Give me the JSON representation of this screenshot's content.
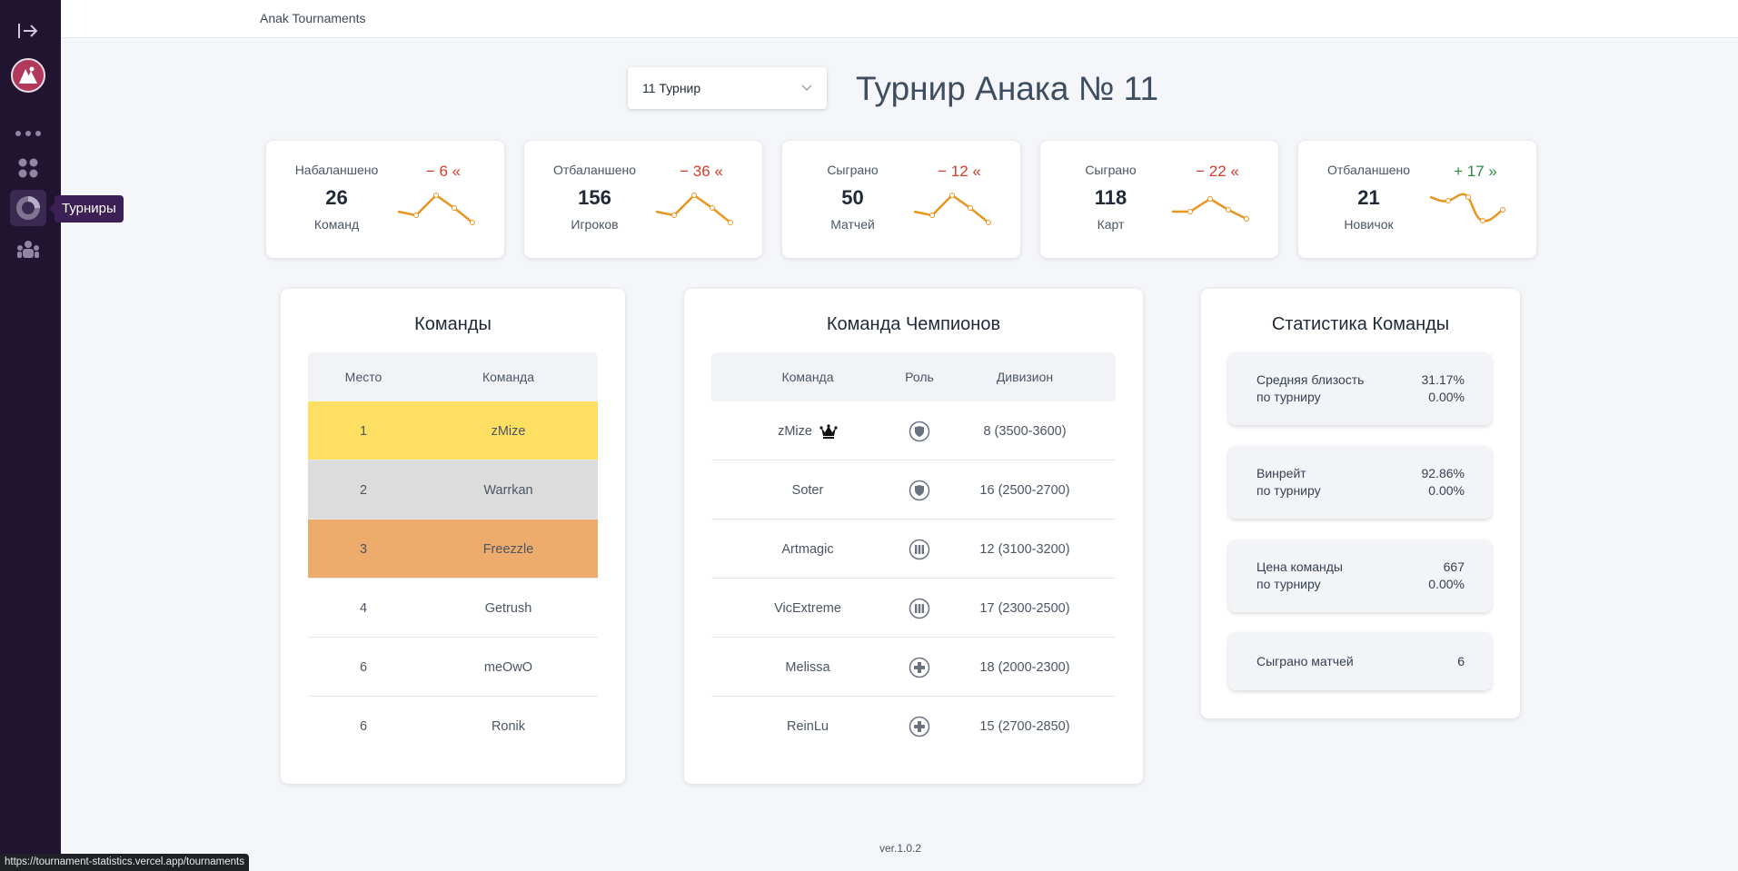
{
  "app": {
    "brand": "Anak Tournaments",
    "tooltip": "Турниры"
  },
  "header": {
    "select_value": "11 Турнир",
    "title": "Турнир Анака № 11"
  },
  "stats": [
    {
      "label": "Набаланшено",
      "value": "26",
      "unit": "Команд",
      "delta": "− 6 «",
      "trend": "negative"
    },
    {
      "label": "Отбаланшено",
      "value": "156",
      "unit": "Игроков",
      "delta": "− 36 «",
      "trend": "negative"
    },
    {
      "label": "Сыграно",
      "value": "50",
      "unit": "Матчей",
      "delta": "− 12 «",
      "trend": "negative"
    },
    {
      "label": "Сыграно",
      "value": "118",
      "unit": "Карт",
      "delta": "− 22 «",
      "trend": "negative"
    },
    {
      "label": "Отбаланшено",
      "value": "21",
      "unit": "Новичок",
      "delta": "+ 17 »",
      "trend": "positive"
    }
  ],
  "teams": {
    "title": "Команды",
    "headers": [
      "Место",
      "Команда"
    ],
    "rows": [
      {
        "place": "1",
        "team": "zMize",
        "color": "#fedf62"
      },
      {
        "place": "2",
        "team": "Warrkan",
        "color": "#dcdcdc"
      },
      {
        "place": "3",
        "team": "Freezzle",
        "color": "#edac6b"
      },
      {
        "place": "4",
        "team": "Getrush",
        "color": "#ffffff"
      },
      {
        "place": "6",
        "team": "meOwO",
        "color": "#ffffff"
      },
      {
        "place": "6",
        "team": "Ronik",
        "color": "#ffffff"
      }
    ]
  },
  "champions": {
    "title": "Команда Чемпионов",
    "headers": [
      "Команда",
      "Роль",
      "Дивизион"
    ],
    "rows": [
      {
        "name": "zMize",
        "role": "tank",
        "division": "8 (3500-3600)",
        "captain": true
      },
      {
        "name": "Soter",
        "role": "tank",
        "division": "16 (2500-2700)",
        "captain": false
      },
      {
        "name": "Artmagic",
        "role": "damage",
        "division": "12 (3100-3200)",
        "captain": false
      },
      {
        "name": "VicExtreme",
        "role": "damage",
        "division": "17 (2300-2500)",
        "captain": false
      },
      {
        "name": "Melissa",
        "role": "support",
        "division": "18 (2000-2300)",
        "captain": false
      },
      {
        "name": "ReinLu",
        "role": "support",
        "division": "15 (2700-2850)",
        "captain": false
      }
    ]
  },
  "team_stats": {
    "title": "Статистика Команды",
    "cards": [
      {
        "line1": "Средняя близость",
        "line2": "по турниру",
        "value1": "31.17%",
        "value2": "0.00%"
      },
      {
        "line1": "Винрейт",
        "line2": "по турниру",
        "value1": "92.86%",
        "value2": "0.00%"
      },
      {
        "line1": "Цена команды",
        "line2": "по турниру",
        "value1": "667",
        "value2": "0.00%"
      },
      {
        "line1": "Сыграно матчей",
        "line2": "",
        "value1": "6",
        "value2": ""
      }
    ]
  },
  "footer": {
    "version": "ver.1.0.2"
  },
  "statusbar": {
    "url": "https://tournament-statistics.vercel.app/tournaments"
  },
  "colors": {
    "sidebar": "#201431",
    "accent": "#e8961f",
    "negative": "#d83b2a",
    "positive": "#2b8a3e"
  }
}
